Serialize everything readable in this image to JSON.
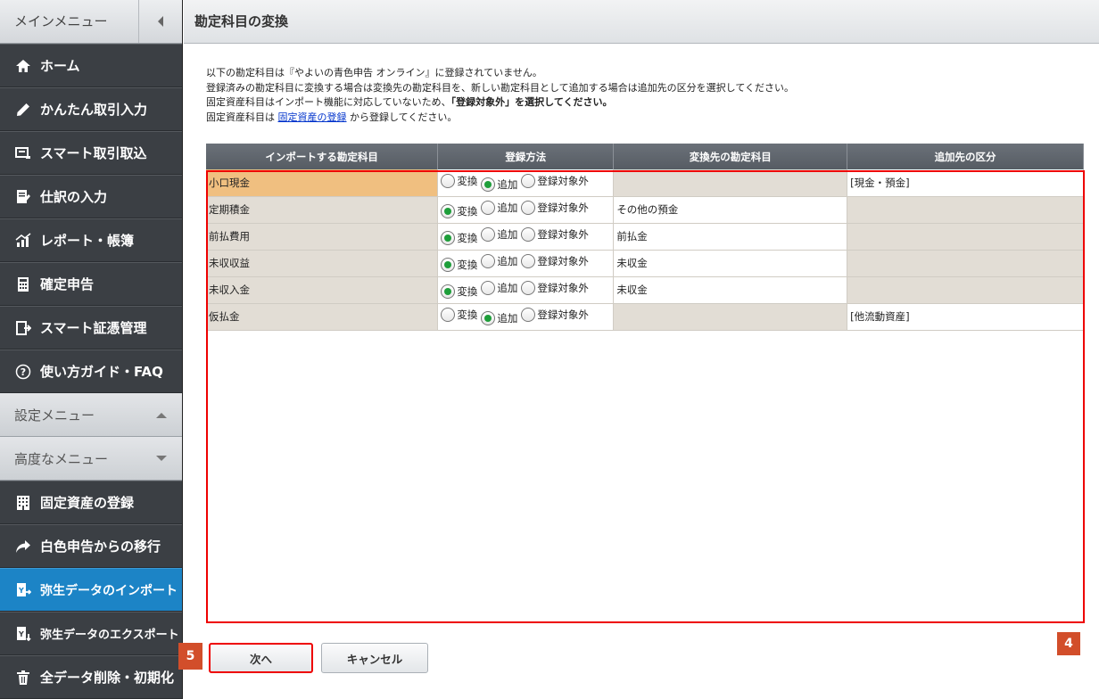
{
  "sidebar": {
    "title": "メインメニュー",
    "items": [
      {
        "label": "ホーム",
        "icon": "home-icon"
      },
      {
        "label": "かんたん取引入力",
        "icon": "pencil-icon"
      },
      {
        "label": "スマート取引取込",
        "icon": "import-icon"
      },
      {
        "label": "仕訳の入力",
        "icon": "journal-icon"
      },
      {
        "label": "レポート・帳簿",
        "icon": "chart-icon"
      },
      {
        "label": "確定申告",
        "icon": "calculator-icon"
      },
      {
        "label": "スマート証憑管理",
        "icon": "document-icon"
      },
      {
        "label": "使い方ガイド・FAQ",
        "icon": "help-icon"
      }
    ],
    "settings_menu": "設定メニュー",
    "advanced_menu": "高度なメニュー",
    "advanced_items": [
      {
        "label": "固定資産の登録",
        "icon": "building-icon"
      },
      {
        "label": "白色申告からの移行",
        "icon": "share-arrow-icon"
      },
      {
        "label": "弥生データのインポート",
        "icon": "data-import-icon",
        "active": true
      },
      {
        "label": "弥生データのエクスポート",
        "icon": "data-export-icon"
      },
      {
        "label": "全データ削除・初期化",
        "icon": "trash-icon"
      }
    ]
  },
  "page": {
    "title": "勘定科目の変換",
    "intro_line1": "以下の勘定科目は『やよいの青色申告 オンライン』に登録されていません。",
    "intro_line2": "登録済みの勘定科目に変換する場合は変換先の勘定科目を、新しい勘定科目として追加する場合は追加先の区分を選択してください。",
    "intro_line3_a": "固定資産科目はインポート機能に対応していないため、",
    "intro_line3_b": "「登録対象外」を選択してください。",
    "intro_line4_a": "固定資産科目は ",
    "intro_line4_link": "固定資産の登録",
    "intro_line4_b": " から登録してください。"
  },
  "table": {
    "headers": [
      "インポートする勘定科目",
      "登録方法",
      "変換先の勘定科目",
      "追加先の区分"
    ],
    "radio_labels": [
      "変換",
      "追加",
      "登録対象外"
    ],
    "rows": [
      {
        "account": "小口現金",
        "method": "追加",
        "target": "",
        "class": "[現金・預金]"
      },
      {
        "account": "定期積金",
        "method": "変換",
        "target": "その他の預金",
        "class": ""
      },
      {
        "account": "前払費用",
        "method": "変換",
        "target": "前払金",
        "class": ""
      },
      {
        "account": "未収収益",
        "method": "変換",
        "target": "未収金",
        "class": ""
      },
      {
        "account": "未収入金",
        "method": "変換",
        "target": "未収金",
        "class": ""
      },
      {
        "account": "仮払金",
        "method": "追加",
        "target": "",
        "class": "[他流動資産]"
      }
    ]
  },
  "buttons": {
    "next": "次へ",
    "cancel": "キャンセル"
  },
  "badges": {
    "table_marker": "4",
    "button_marker": "5"
  }
}
